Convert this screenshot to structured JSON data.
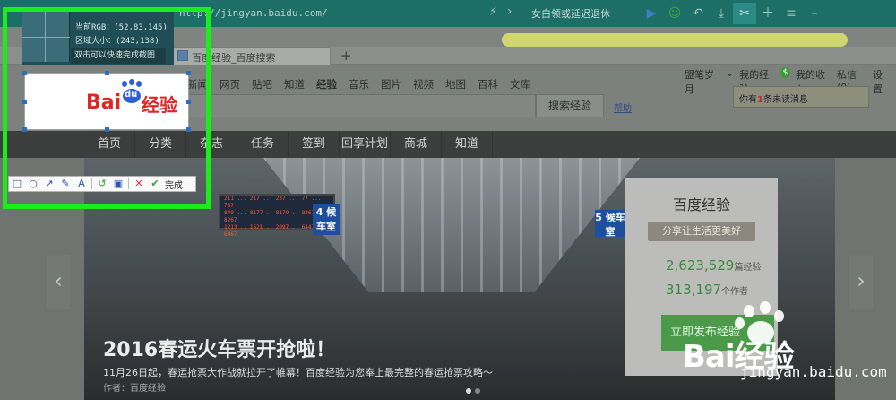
{
  "browser": {
    "url": "http://jingyan.baidu.com/",
    "search_text": "女白领或延迟退休",
    "toolbar_icons": [
      "play-icon",
      "smile-icon",
      "undo-icon",
      "download-icon",
      "scissors-icon",
      "plus-icon",
      "menu-icon",
      "minimize-icon"
    ],
    "tab_title": "百度经验_百度搜索",
    "new_tab": "+"
  },
  "page": {
    "nav_links": [
      "新闻",
      "网页",
      "贴吧",
      "知道",
      "经验",
      "音乐",
      "图片",
      "视频",
      "地图",
      "百科",
      "文库"
    ],
    "search_button": "搜索经验",
    "help": "帮助",
    "user": {
      "name": "盟笔岁月",
      "links": [
        "我的经验",
        "我的收入",
        "私信(0)",
        "设置"
      ],
      "notice_prefix": "你有",
      "notice_count": "1",
      "notice_suffix": "条未读消息"
    },
    "navbar": [
      "首页",
      "分类",
      "杂志",
      "任务",
      "签到",
      "回享计划",
      "商城",
      "知道"
    ]
  },
  "banner": {
    "title": "2016春运火车票开抢啦！",
    "subtitle": "11月26日起，春运抢票大作战就拉开了帷幕！百度经验为您奉上最完整的春运抢票攻略～",
    "author": "作者：百度经验",
    "board_lines": [
      "211 ... 217 ... 237 ... 77 ... 787",
      "849 ... 8177 .. 8179 .. 8267 .. 8267",
      "1213 .. 1621 .. 2097 .. 6447 .. 6467"
    ],
    "sign_left": "4 候车室",
    "sign_right": "5 候车室",
    "card": {
      "title": "百度经验",
      "slogan": "分享让生活更美好",
      "experience_count": "2,623,529",
      "experience_label": "篇经验",
      "author_count": "313,197",
      "author_label": "个作者",
      "button": "立即发布经验"
    },
    "watermark_text": "Bai经验",
    "watermark_url": "jingyan.baidu.com"
  },
  "capture_tool": {
    "rgb": "当前RGB：(52,83,145)",
    "size": "区域大小：(243,138)",
    "hint": "双击可以快速完成截图",
    "logo_bai": "Bai",
    "logo_du": "du",
    "logo_jy": "经验",
    "done": "完成",
    "frame_color": "#19ee19"
  }
}
